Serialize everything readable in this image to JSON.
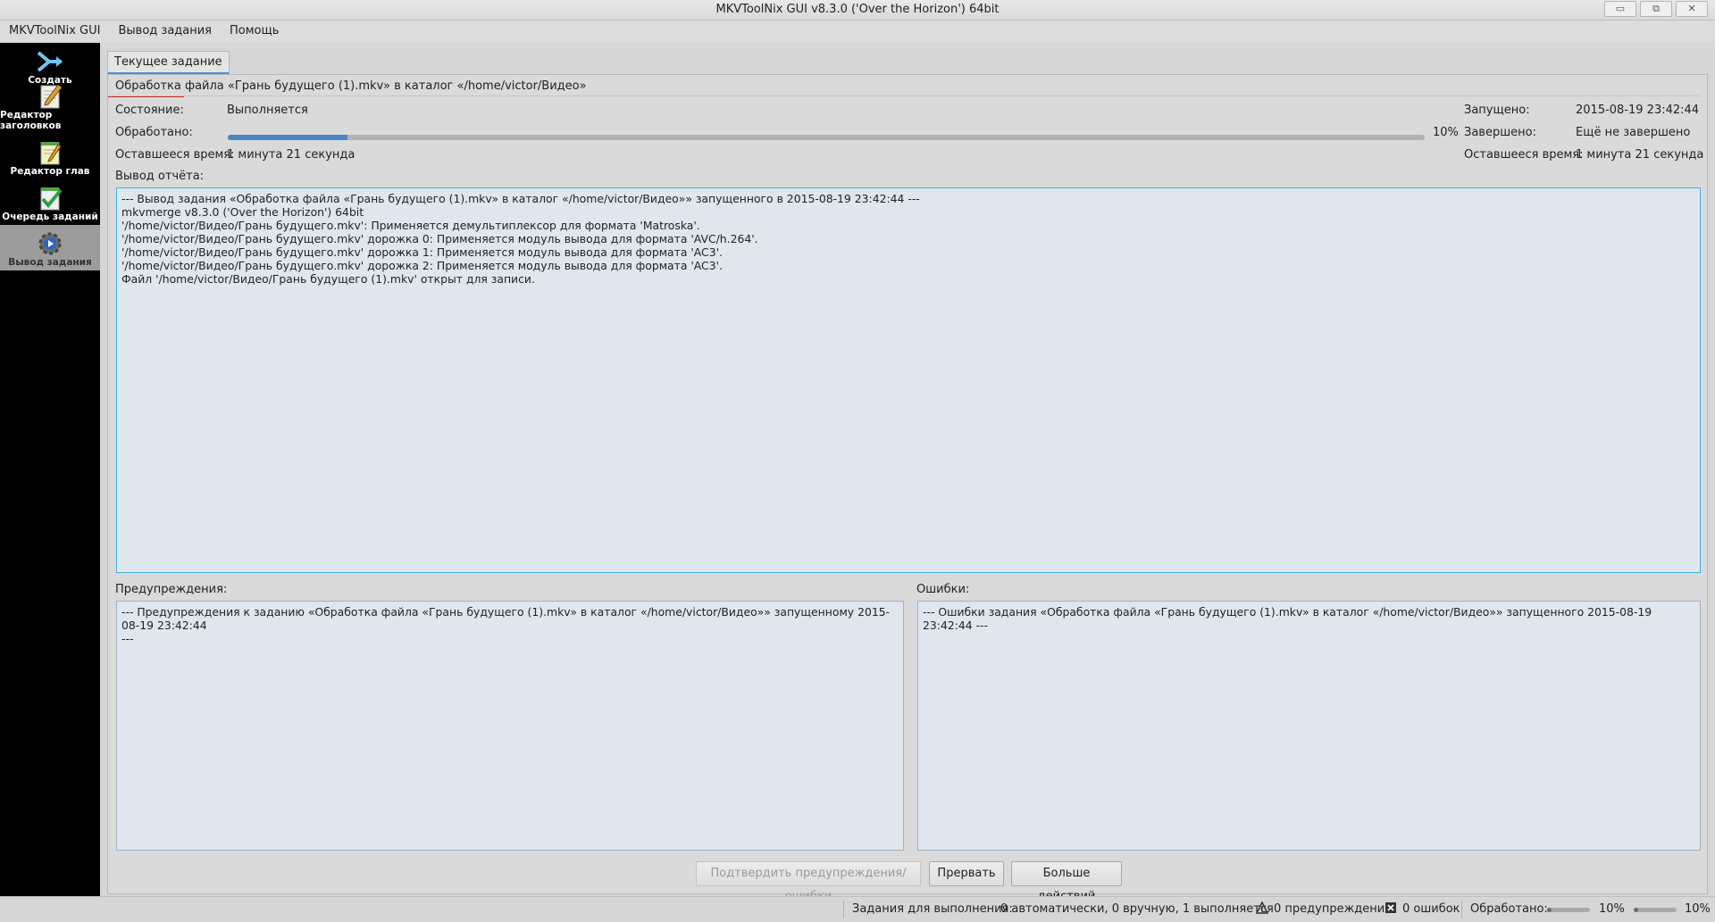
{
  "window": {
    "title": "MKVToolNix GUI v8.3.0 ('Over the Horizon') 64bit"
  },
  "menu": [
    "MKVToolNix GUI",
    "Вывод задания",
    "Помощь"
  ],
  "sidebar": {
    "items": [
      {
        "label": "Создать",
        "icon": "merge-arrows-icon"
      },
      {
        "label": "Редактор заголовков",
        "icon": "header-editor-pencil-icon"
      },
      {
        "label": "Редактор глав",
        "icon": "chapter-editor-notepad-icon"
      },
      {
        "label": "Очередь заданий",
        "icon": "job-queue-checkmark-icon"
      },
      {
        "label": "Вывод задания",
        "icon": "job-output-gear-icon"
      }
    ]
  },
  "tab": {
    "label": "Текущее задание"
  },
  "job": {
    "description": "Обработка файла «Грань будущего (1).mkv» в каталог «/home/victor/Видео»",
    "status_label": "Состояние:",
    "status_value": "Выполняется",
    "processed_label": "Обработано:",
    "progress_percent": 10,
    "progress_text": "10%",
    "remaining_label": "Оставшееся время:",
    "remaining_value": "1 минута 21 секунда",
    "started_label": "Запущено:",
    "started_value": "2015-08-19 23:42:44",
    "finished_label": "Завершено:",
    "finished_value": "Ещё не завершено",
    "remaining_label_right": "Оставшееся время:",
    "remaining_value_right": "1 минута 21 секунда",
    "output_label": "Вывод отчёта:",
    "output_text": "--- Вывод задания «Обработка файла «Грань будущего (1).mkv» в каталог «/home/victor/Видео»» запущенного в 2015-08-19 23:42:44 ---\nmkvmerge v8.3.0 ('Over the Horizon') 64bit\n'/home/victor/Видео/Грань будущего.mkv': Применяется демультиплексор для формата 'Matroska'.\n'/home/victor/Видео/Грань будущего.mkv' дорожка 0: Применяется модуль вывода для формата 'AVC/h.264'.\n'/home/victor/Видео/Грань будущего.mkv' дорожка 1: Применяется модуль вывода для формата 'AC3'.\n'/home/victor/Видео/Грань будущего.mkv' дорожка 2: Применяется модуль вывода для формата 'AC3'.\nФайл '/home/victor/Видео/Грань будущего (1).mkv' открыт для записи.",
    "warnings_label": "Предупреждения:",
    "warnings_text": "--- Предупреждения к заданию «Обработка файла «Грань будущего (1).mkv» в каталог «/home/victor/Видео»» запущенному 2015-08-19 23:42:44\n---",
    "errors_label": "Ошибки:",
    "errors_text": "--- Ошибки задания «Обработка файла «Грань будущего (1).mkv» в каталог «/home/victor/Видео»» запущенного 2015-08-19 23:42:44 ---"
  },
  "buttons": {
    "acknowledge": "Подтвердить предупреждения/ошибки",
    "abort": "Прервать",
    "more": "Больше действий"
  },
  "statusbar": {
    "jobs_label": "Задания для выполнения:",
    "jobs_value": "0 автоматически, 0 вручную, 1 выполняется",
    "warnings": "0 предупреждений",
    "errors": "0 ошибок",
    "processed_label": "Обработано:",
    "processed_value1": "10%",
    "processed_value2": "10%",
    "progress1_percent": 10,
    "progress2_percent": 10
  },
  "colors": {
    "accent": "#4a86c8",
    "focus_border": "#3fb0d8",
    "sidebar": "#000000"
  }
}
